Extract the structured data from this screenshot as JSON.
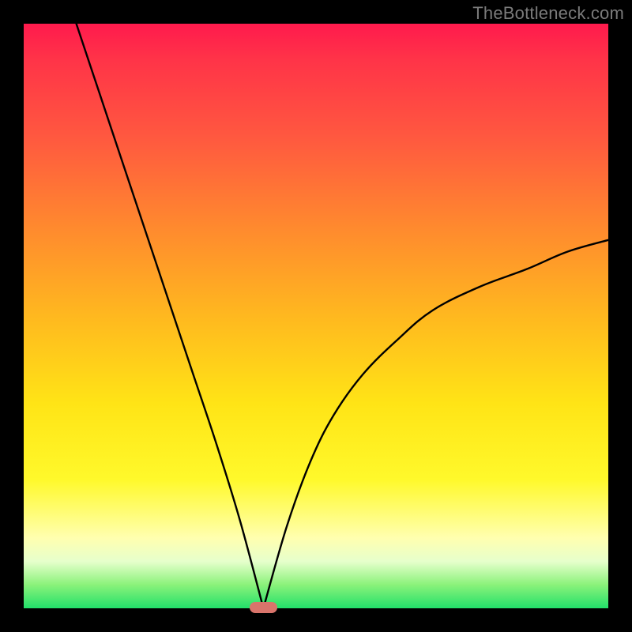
{
  "watermark": "TheBottleneck.com",
  "colors": {
    "frame": "#000000",
    "watermark": "#7a7a7a",
    "curve": "#000000",
    "marker": "#d9746b",
    "gradient_stops": [
      "#ff1a4d",
      "#ff3348",
      "#ff5a3f",
      "#ff8a2e",
      "#ffb81f",
      "#ffe416",
      "#fff92b",
      "#ffffb0",
      "#e6ffcc",
      "#8af27a",
      "#22e06a"
    ]
  },
  "chart_data": {
    "type": "line",
    "title": "",
    "xlabel": "",
    "ylabel": "",
    "xlim": [
      0,
      100
    ],
    "ylim": [
      0,
      100
    ],
    "min_x": 41,
    "left_top_x": 9,
    "right_end_y": 63,
    "series": [
      {
        "name": "bottleneck-curve",
        "x": [
          9,
          13,
          17,
          21,
          25,
          29,
          33,
          37,
          41,
          45,
          49,
          53,
          58,
          64,
          70,
          78,
          86,
          93,
          100
        ],
        "y": [
          100,
          88,
          76,
          64,
          52,
          40,
          28,
          15,
          0,
          14,
          25,
          33,
          40,
          46,
          51,
          55,
          58,
          61,
          63
        ]
      }
    ],
    "marker": {
      "x": 41,
      "y": 0,
      "width_pct": 4.8,
      "height_pct": 1.9
    }
  }
}
